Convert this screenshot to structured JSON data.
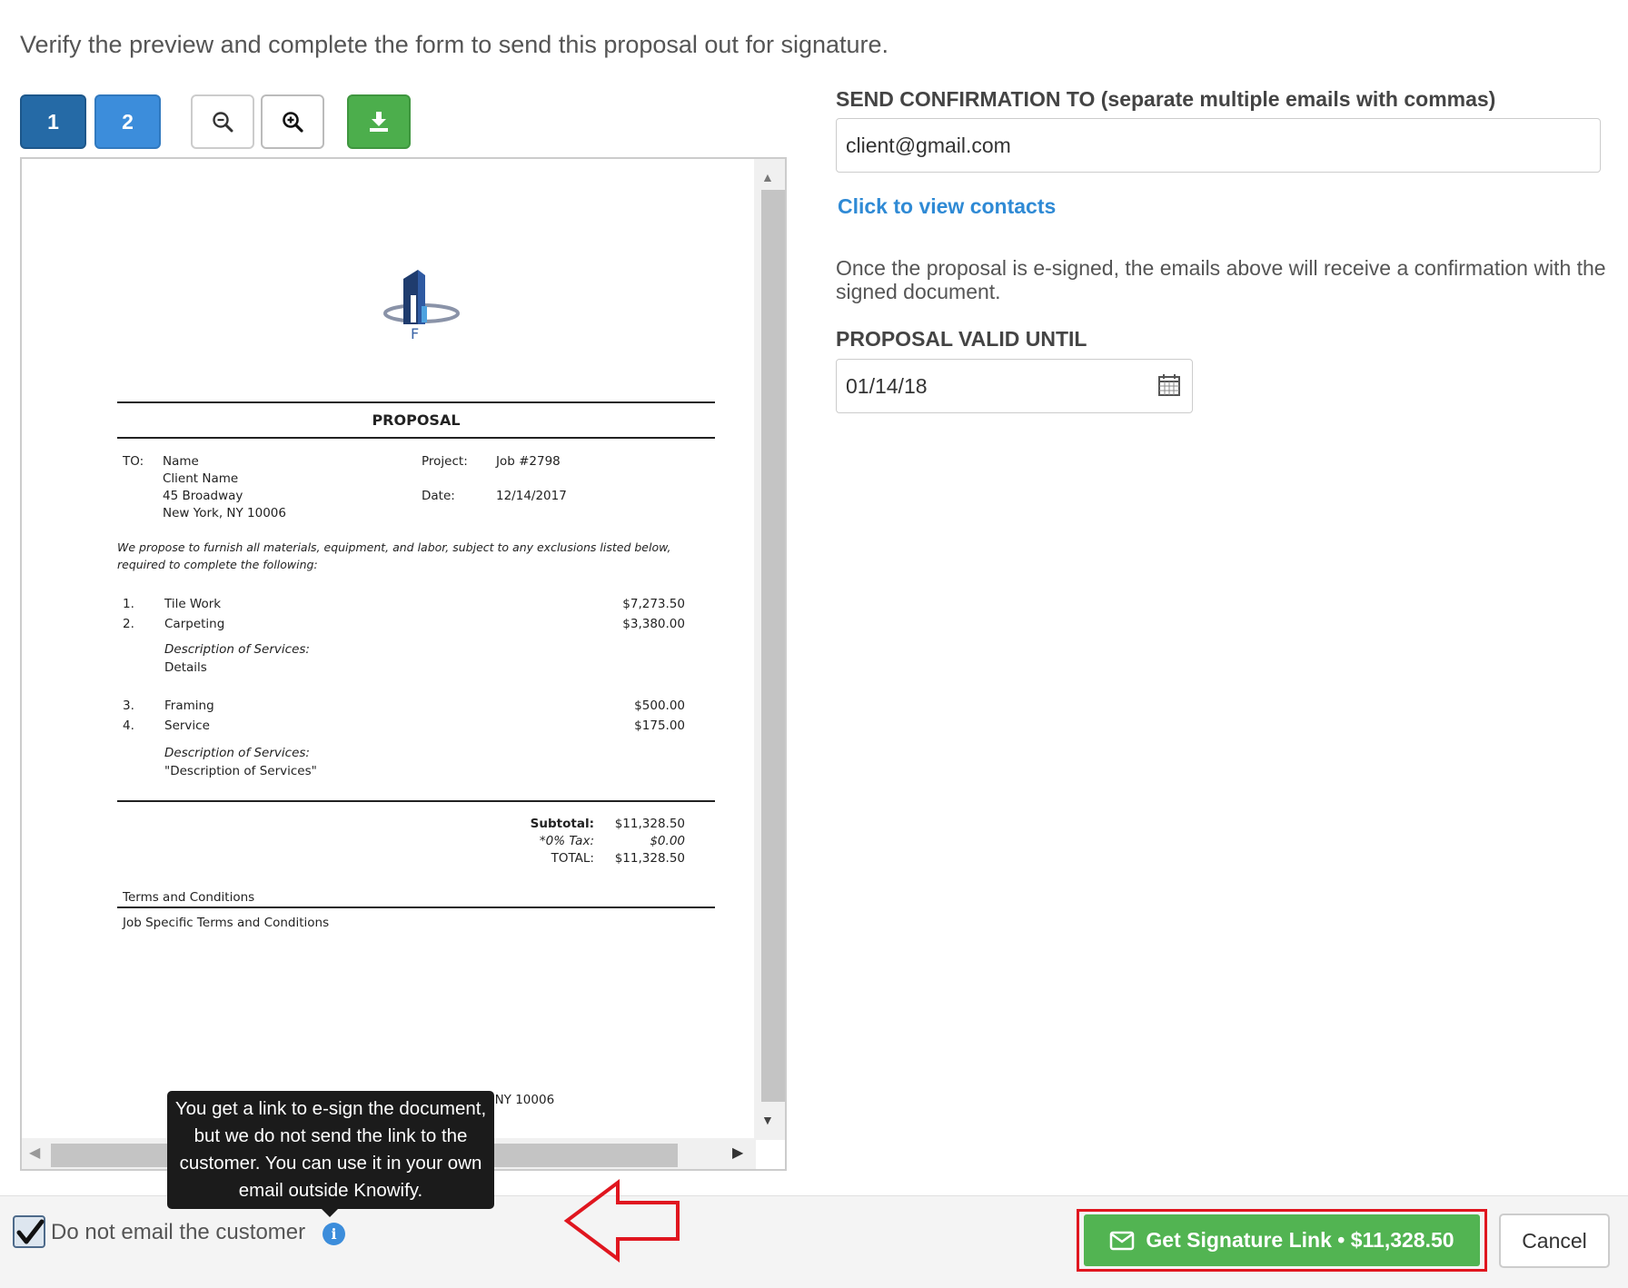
{
  "instructions": "Verify the preview and complete the form to send this proposal out for signature.",
  "toolbar": {
    "page_buttons": [
      "1",
      "2"
    ],
    "zoom_out_icon": "zoom-out-icon",
    "zoom_in_icon": "zoom-in-icon",
    "download_icon": "download-icon"
  },
  "document": {
    "logo_letter": "F",
    "title": "PROPOSAL",
    "to_label": "TO:",
    "to_lines": [
      "Name",
      "Client Name",
      "45 Broadway",
      "New York, NY 10006"
    ],
    "project_label": "Project:",
    "project_value": "Job #2798",
    "date_label": "Date:",
    "date_value": "12/14/2017",
    "intro_line1": "We propose to furnish all materials, equipment, and labor, subject to any exclusions listed below,",
    "intro_line2": "required to complete the following:",
    "items": [
      {
        "num": "1.",
        "name": "Tile Work",
        "amount": "$7,273.50"
      },
      {
        "num": "2.",
        "name": "Carpeting",
        "amount": "$3,380.00"
      },
      {
        "num": "3.",
        "name": "Framing",
        "amount": "$500.00"
      },
      {
        "num": "4.",
        "name": "Service",
        "amount": "$175.00"
      }
    ],
    "desc_label": "Description of Services:",
    "desc1_value": "Details",
    "desc2_value": "\"Description of Services\"",
    "subtotal_label": "Subtotal:",
    "subtotal_value": "$11,328.50",
    "tax_label": "*0% Tax:",
    "tax_value": "$0.00",
    "total_label": "TOTAL:",
    "total_value": "$11,328.50",
    "terms_heading": "Terms and Conditions",
    "terms_text": "Job Specific Terms and Conditions",
    "footer_text": ", NY 10006"
  },
  "form": {
    "send_label": "SEND CONFIRMATION TO (separate multiple emails with commas)",
    "email_value": "client@gmail.com",
    "contacts_link": "Click to view contacts",
    "note": "Once the proposal is e-signed, the emails above will receive a confirmation with the signed document.",
    "valid_label": "PROPOSAL VALID UNTIL",
    "valid_value": "01/14/18"
  },
  "footer": {
    "checkbox_label": "Do not email the customer",
    "checkbox_checked": true,
    "info_icon_glyph": "i",
    "tooltip": "You get a link to e-sign the document, but we do not send the link to the customer. You can use it in your own email outside Knowify.",
    "signature_button": "Get Signature Link • $11,328.50",
    "cancel_button": "Cancel"
  },
  "colors": {
    "primary_blue": "#256aa6",
    "secondary_blue": "#3c8ddb",
    "success_green": "#52b452",
    "highlight_red": "#e0161f",
    "link_blue": "#2f8ad5"
  }
}
